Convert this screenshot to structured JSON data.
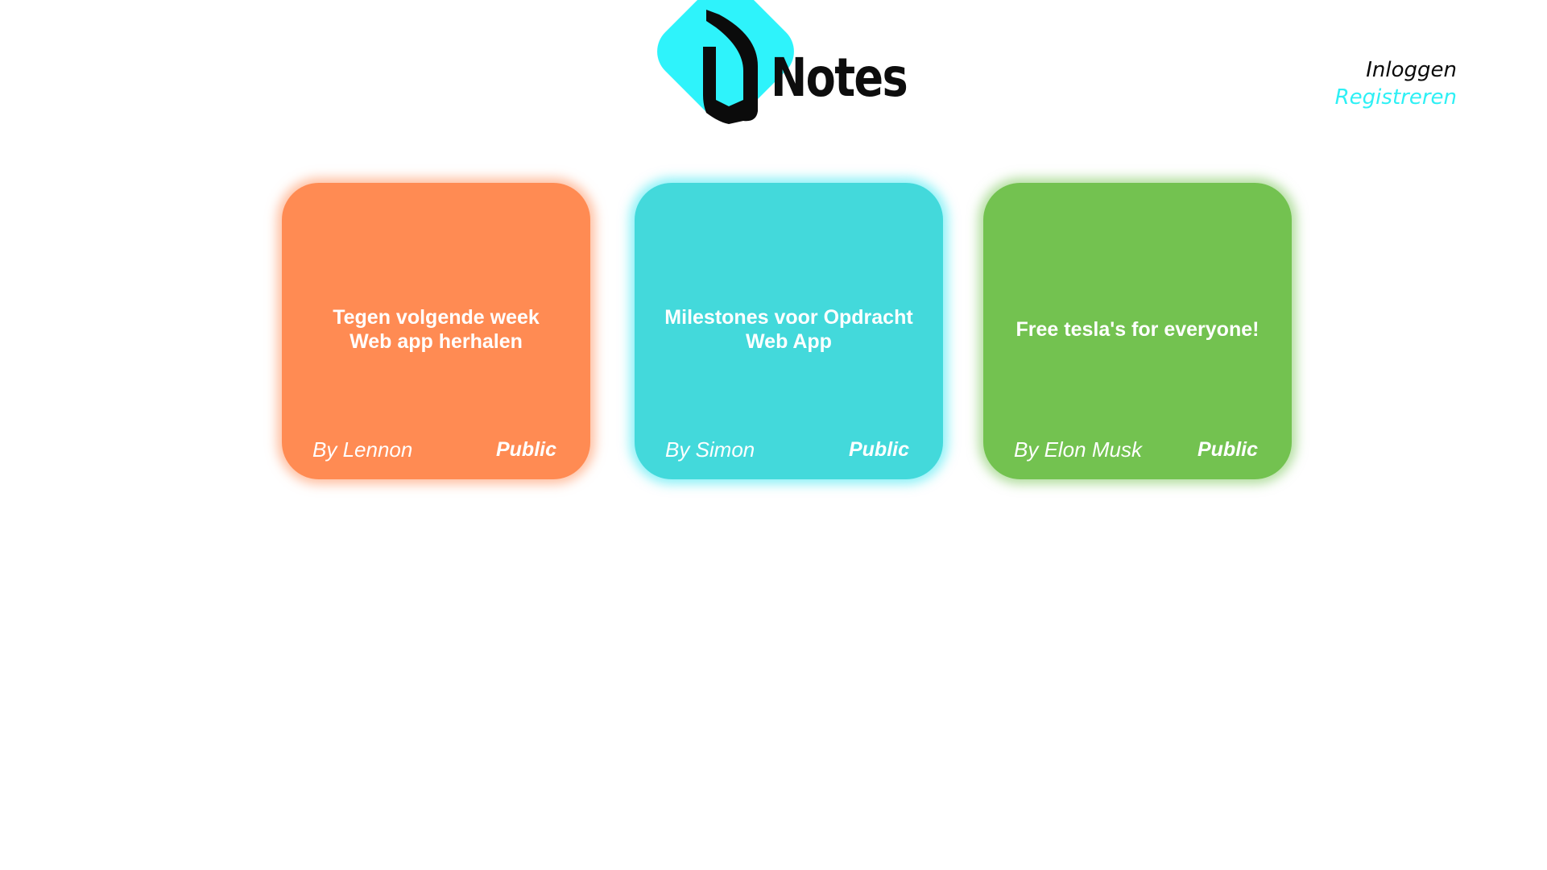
{
  "brand": {
    "name": "Notes",
    "logo_icon": "j-logo-icon",
    "logo_color": "#2ef3fb"
  },
  "auth": {
    "login_label": "Inloggen",
    "register_label": "Registreren",
    "register_color": "#2ef0f5"
  },
  "notes": [
    {
      "title_line1": "Tegen volgende week",
      "title_line2": "Web app herhalen",
      "author": "By Lennon",
      "visibility": "Public",
      "color": "#ff8b53"
    },
    {
      "title_line1": "Milestones voor Opdracht",
      "title_line2": "Web App",
      "author": "By Simon",
      "visibility": "Public",
      "color": "#43d9db"
    },
    {
      "title_line1": "Free tesla's for everyone!",
      "title_line2": "",
      "author": "By Elon Musk",
      "visibility": "Public",
      "color": "#73c250"
    }
  ]
}
